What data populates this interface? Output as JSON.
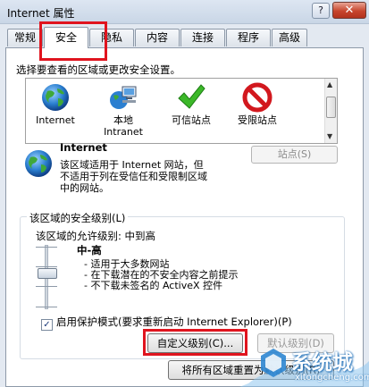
{
  "window": {
    "title": "Internet 属性",
    "help": "?",
    "close": "✕"
  },
  "tabs": [
    {
      "label": "常规"
    },
    {
      "label": "安全"
    },
    {
      "label": "隐私"
    },
    {
      "label": "内容"
    },
    {
      "label": "连接"
    },
    {
      "label": "程序"
    },
    {
      "label": "高级"
    }
  ],
  "instruction": "选择要查看的区域或更改安全设置。",
  "zones": [
    {
      "label": "Internet",
      "icon": "globe-icon"
    },
    {
      "label": "本地\nIntranet",
      "icon": "intranet-icon"
    },
    {
      "label": "可信站点",
      "icon": "checkmark-icon"
    },
    {
      "label": "受限站点",
      "icon": "restricted-icon"
    }
  ],
  "zone_info": {
    "title": "Internet",
    "description": "该区域适用于 Internet 网站，但\n不适用于列在受信任和受限制区域\n中的网站。",
    "sites_button": "站点(S)"
  },
  "security_level": {
    "group_label": "该区域的安全级别(L)",
    "allowed": "该区域的允许级别: 中到高",
    "level_name": "中-高",
    "bullets": [
      "- 适用于大多数网站",
      "- 在下载潜在的不安全内容之前提示",
      "- 不下载未签名的 ActiveX 控件"
    ],
    "protected_mode": "启用保护模式(要求重新启动 Internet Explorer)(P)",
    "protected_checked": "✓",
    "custom_button": "自定义级别(C)...",
    "default_button": "默认级别(D)",
    "reset_all_button": "将所有区域重置为默认级别(R)"
  },
  "watermark": {
    "text": "系统城",
    "url": "xitongcheng.com"
  },
  "colors": {
    "highlight": "#e0141e",
    "window_bg": "#e3e9f1"
  }
}
